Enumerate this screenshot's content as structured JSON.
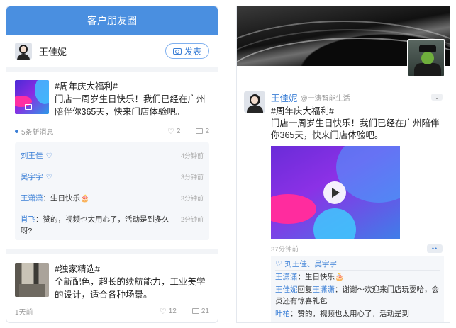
{
  "left": {
    "header_title": "客户朋友圈",
    "profile_name": "王佳妮",
    "publish_label": "发表",
    "posts": [
      {
        "text": "#周年庆大福利#\n门店一周岁生日快乐！我们已经在广州陪伴你365天，快来门店体验吧。",
        "meta_left": "5条新消息",
        "likes": "2",
        "comments": "2"
      },
      {
        "text": "#独家精选#\n全新配色，超长的续航能力，工业美学的设计，适合各种场景。",
        "meta_left": "1天前",
        "likes": "12",
        "comments": "21"
      }
    ],
    "comment_list": [
      {
        "name": "刘王佳",
        "text": "",
        "time": "4分钟前",
        "liked": true
      },
      {
        "name": "吴宇宇",
        "text": "",
        "time": "3分钟前",
        "liked": true
      },
      {
        "name": "王潇潇",
        "text": "：生日快乐🎂",
        "time": "3分钟前",
        "liked": false
      },
      {
        "name": "肖飞",
        "text": "：赞的，视频也太用心了，活动是到多久呀?",
        "time": "2分钟前",
        "liked": false
      }
    ]
  },
  "right": {
    "name": "王佳妮",
    "handle": "@一涛智能生活",
    "text": "#周年庆大福利#\n门店一周岁生日快乐！我们已经在广州陪伴你365天，快来门店体验吧。",
    "time": "37分钟前",
    "likes": "刘王佳、吴宇宇",
    "comments": [
      {
        "name": "王潇潇",
        "text": "：生日快乐🎂"
      },
      {
        "name": "王佳妮",
        "reply_word": "回复",
        "to": "王潇潇",
        "text": "：谢谢～欢迎来门店玩耍哈，会员还有惊喜礼包"
      },
      {
        "name": "叶柏",
        "text": "：赞的，视频也太用心了，活动是到"
      }
    ]
  },
  "colors": {
    "accent": "#4a8fe0",
    "link": "#3b7fd6"
  },
  "icons": [
    "camera-icon",
    "heart-icon",
    "comment-icon",
    "play-icon",
    "chevron-down-icon",
    "more-icon"
  ]
}
